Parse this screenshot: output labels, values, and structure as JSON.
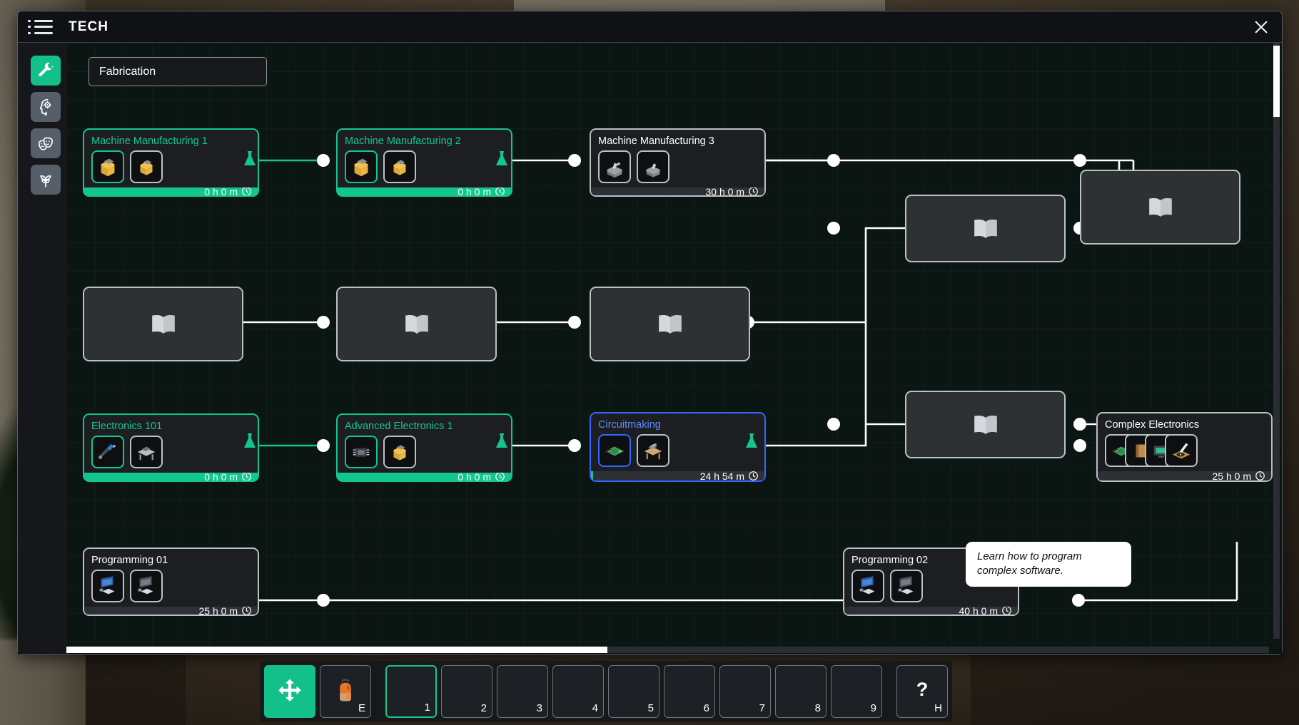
{
  "window": {
    "title": "TECH",
    "menu_icon": "hamburger-icon",
    "close_icon": "close-icon"
  },
  "sidebar": {
    "items": [
      {
        "name": "fabrication",
        "icon": "wrench-icon",
        "active": true
      },
      {
        "name": "research",
        "icon": "head-gear-icon",
        "active": false
      },
      {
        "name": "entertainment",
        "icon": "theater-masks-icon",
        "active": false
      },
      {
        "name": "nature",
        "icon": "plant-icon",
        "active": false
      }
    ]
  },
  "category": {
    "label": "Fabrication"
  },
  "tooltip": {
    "text": "Learn how to program complex software."
  },
  "nodes": [
    {
      "id": "mm1",
      "title": "Machine Manufacturing 1",
      "time": "0 h 0 m",
      "state": "completed"
    },
    {
      "id": "mm2",
      "title": "Machine Manufacturing 2",
      "time": "0 h 0 m",
      "state": "completed"
    },
    {
      "id": "mm3",
      "title": "Machine Manufacturing 3",
      "time": "30 h 0 m",
      "state": "locked"
    },
    {
      "id": "e101",
      "title": "Electronics 101",
      "time": "0 h 0 m",
      "state": "completed"
    },
    {
      "id": "ae1",
      "title": "Advanced Electronics 1",
      "time": "0 h 0 m",
      "state": "completed"
    },
    {
      "id": "circ",
      "title": "Circuitmaking",
      "time": "24 h 54 m",
      "state": "selected"
    },
    {
      "id": "cplx",
      "title": "Complex Electronics",
      "time": "25 h 0 m",
      "state": "locked"
    },
    {
      "id": "p01",
      "title": "Programming 01",
      "time": "25 h 0 m",
      "state": "locked"
    },
    {
      "id": "p02",
      "title": "Programming 02",
      "time": "40 h 0 m",
      "state": "locked"
    }
  ],
  "hidden_nodes": [
    {
      "id": "h1",
      "icon": "book-icon"
    },
    {
      "id": "h2",
      "icon": "book-icon"
    },
    {
      "id": "h3",
      "icon": "book-icon"
    },
    {
      "id": "h4",
      "icon": "book-icon"
    },
    {
      "id": "h5",
      "icon": "book-icon"
    },
    {
      "id": "h6",
      "icon": "book-icon"
    },
    {
      "id": "h7",
      "icon": "book-icon"
    }
  ],
  "hotbar": {
    "move": {
      "icon": "move-arrows-icon",
      "key": ""
    },
    "backpack": {
      "icon": "backpack-icon",
      "key": "E"
    },
    "slots": [
      {
        "key": "1",
        "selected": true
      },
      {
        "key": "2",
        "selected": false
      },
      {
        "key": "3",
        "selected": false
      },
      {
        "key": "4",
        "selected": false
      },
      {
        "key": "5",
        "selected": false
      },
      {
        "key": "6",
        "selected": false
      },
      {
        "key": "7",
        "selected": false
      },
      {
        "key": "8",
        "selected": false
      },
      {
        "key": "9",
        "selected": false
      }
    ],
    "help": {
      "glyph": "?",
      "key": "H"
    }
  },
  "colors": {
    "accent_green": "#13c78c",
    "selection_blue": "#3366ff",
    "rail_blue": "#1a18f0",
    "panel": "#1c1e21",
    "canvas": "#0b1512"
  }
}
